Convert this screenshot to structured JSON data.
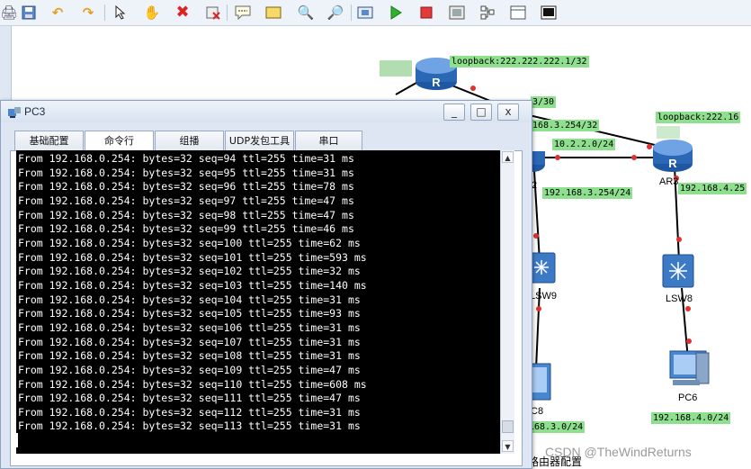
{
  "toolbar": {
    "icons": [
      "print-icon",
      "save-icon",
      "undo-icon",
      "redo-icon",
      "select-icon",
      "pan-hand-icon",
      "delete-icon",
      "delete-link-icon",
      "text-note-icon",
      "rectangle-icon",
      "zoom-in-icon",
      "zoom-out-icon",
      "fit-icon",
      "start-icon",
      "stop-icon",
      "capture-icon",
      "topology-icon",
      "grid-icon",
      "terminal-icon"
    ]
  },
  "topology": {
    "labels": {
      "ar_top_loopback": "loopback:222.222.222.1/32",
      "ar3_loopback": "loopback:222.16",
      "net_30": "3/30",
      "net_168_3_254_32": "168.3.254/32",
      "net_10_2_2_0": "10.2.2.0/24",
      "net_168_3_254_24": "192.168.3.254/24",
      "net_168_4_25": "192.168.4.25",
      "net_168_3_0": "168.3.0/24",
      "net_168_4_0": "192.168.4.0/24"
    },
    "devices": {
      "ar3": "AR3",
      "lsw9": "LSW9",
      "lsw8": "LSW8",
      "pc6": "PC6",
      "pc8_partial": "C8",
      "node_partial": "2"
    },
    "bottom_partial_text": "路由器配置",
    "watermark": "CSDN @TheWindReturns"
  },
  "pc3_window": {
    "title": "PC3",
    "buttons": {
      "minimize": "_",
      "maximize": "□",
      "close": "x"
    },
    "tabs": [
      "基础配置",
      "命令行",
      "组播",
      "UDP发包工具",
      "串口"
    ],
    "active_tab": "命令行",
    "console_lines": [
      "From 192.168.0.254: bytes=32 seq=94 ttl=255 time=31 ms",
      "From 192.168.0.254: bytes=32 seq=95 ttl=255 time=31 ms",
      "From 192.168.0.254: bytes=32 seq=96 ttl=255 time=78 ms",
      "From 192.168.0.254: bytes=32 seq=97 ttl=255 time=47 ms",
      "From 192.168.0.254: bytes=32 seq=98 ttl=255 time=47 ms",
      "From 192.168.0.254: bytes=32 seq=99 ttl=255 time=46 ms",
      "From 192.168.0.254: bytes=32 seq=100 ttl=255 time=62 ms",
      "From 192.168.0.254: bytes=32 seq=101 ttl=255 time=593 ms",
      "From 192.168.0.254: bytes=32 seq=102 ttl=255 time=32 ms",
      "From 192.168.0.254: bytes=32 seq=103 ttl=255 time=140 ms",
      "From 192.168.0.254: bytes=32 seq=104 ttl=255 time=31 ms",
      "From 192.168.0.254: bytes=32 seq=105 ttl=255 time=93 ms",
      "From 192.168.0.254: bytes=32 seq=106 ttl=255 time=31 ms",
      "From 192.168.0.254: bytes=32 seq=107 ttl=255 time=31 ms",
      "From 192.168.0.254: bytes=32 seq=108 ttl=255 time=31 ms",
      "From 192.168.0.254: bytes=32 seq=109 ttl=255 time=47 ms",
      "From 192.168.0.254: bytes=32 seq=110 ttl=255 time=608 ms",
      "From 192.168.0.254: bytes=32 seq=111 ttl=255 time=47 ms",
      "From 192.168.0.254: bytes=32 seq=112 ttl=255 time=31 ms",
      "From 192.168.0.254: bytes=32 seq=113 ttl=255 time=31 ms"
    ]
  },
  "colors": {
    "label_bg": "#8ee08e",
    "link": "#000000",
    "port_dot": "#e03030",
    "router": "#2a67b5"
  }
}
